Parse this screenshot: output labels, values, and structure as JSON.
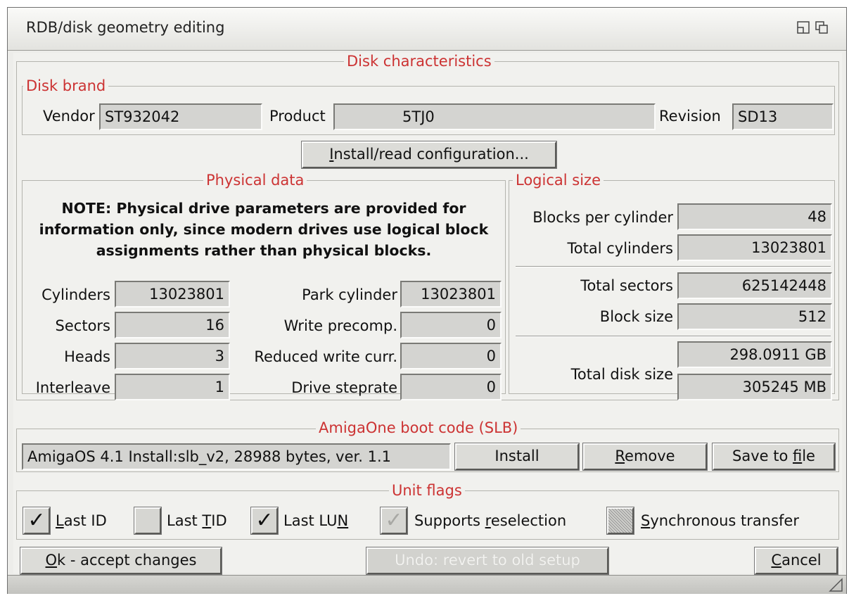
{
  "window": {
    "title": "RDB/disk geometry editing"
  },
  "disk_characteristics": {
    "title": "Disk characteristics",
    "brand": {
      "title": "Disk brand",
      "vendor_label": "Vendor",
      "vendor_value": "ST932042",
      "product_label": "Product",
      "product_value": "5TJ0",
      "revision_label": "Revision",
      "revision_value": "SD13"
    },
    "install_button": {
      "pre": "",
      "key": "I",
      "post": "nstall/read configuration..."
    },
    "physical": {
      "title": "Physical data",
      "note": "NOTE: Physical drive parameters are provided for information only, since modern drives use logical block assignments rather than physical blocks.",
      "cylinders_label": "Cylinders",
      "cylinders_value": "13023801",
      "sectors_label": "Sectors",
      "sectors_value": "16",
      "heads_label": "Heads",
      "heads_value": "3",
      "interleave_label": "Interleave",
      "interleave_value": "1",
      "park_label": "Park cylinder",
      "park_value": "13023801",
      "precomp_label": "Write precomp.",
      "precomp_value": "0",
      "reduced_label": "Reduced write curr.",
      "reduced_value": "0",
      "steprate_label": "Drive steprate",
      "steprate_value": "0"
    },
    "logical": {
      "title": "Logical size",
      "bpc_label": "Blocks per cylinder",
      "bpc_value": "48",
      "tcyl_label": "Total cylinders",
      "tcyl_value": "13023801",
      "tsec_label": "Total sectors",
      "tsec_value": "625142448",
      "bsize_label": "Block size",
      "bsize_value": "512",
      "tdisk_label": "Total disk size",
      "tdisk_gb": "298.0911 GB",
      "tdisk_mb": "305245 MB"
    }
  },
  "boot": {
    "title": "AmigaOne boot code (SLB)",
    "info": "AmigaOS 4.1 Install:slb_v2, 28988 bytes, ver. 1.1",
    "install_label": "Install",
    "remove": {
      "pre": "",
      "key": "R",
      "post": "emove"
    },
    "save": {
      "pre": "Save to ",
      "key": "f",
      "post": "ile"
    }
  },
  "unit_flags": {
    "title": "Unit flags",
    "last_id": {
      "pre": "",
      "key": "L",
      "post": "ast ID",
      "checked": true
    },
    "last_tid": {
      "pre": "Last ",
      "key": "T",
      "post": "ID",
      "checked": false
    },
    "last_lun": {
      "pre": "Last LU",
      "key": "N",
      "post": "",
      "checked": true
    },
    "reselection": {
      "pre": "Supports ",
      "key": "r",
      "post": "eselection",
      "checked": true,
      "disabled": true
    },
    "sync": {
      "pre": "",
      "key": "S",
      "post": "ynchronous transfer",
      "checked": false,
      "disabled": true
    }
  },
  "footer": {
    "ok": {
      "pre": "",
      "key": "O",
      "post": "k - accept changes"
    },
    "undo_label": "Undo: revert to old setup",
    "cancel": {
      "pre": "",
      "key": "C",
      "post": "ancel"
    }
  },
  "check_glyph": "✓"
}
